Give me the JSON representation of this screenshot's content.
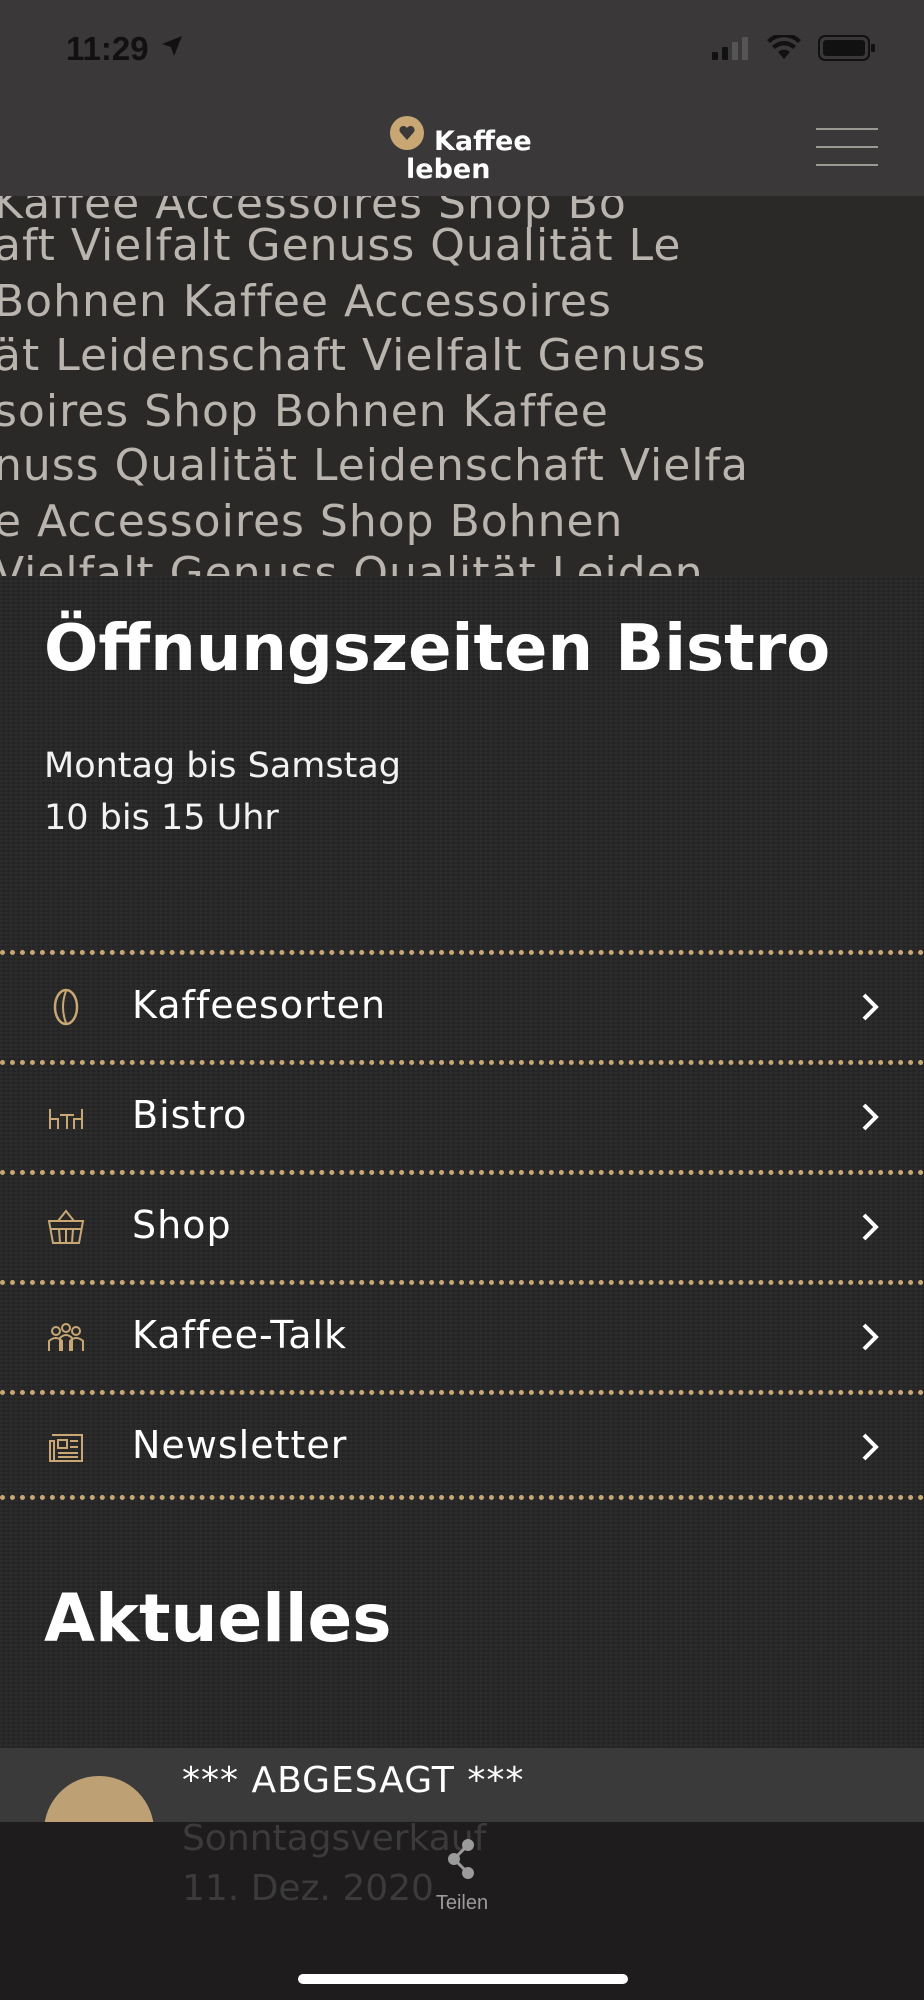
{
  "status_bar": {
    "time": "11:29"
  },
  "header": {
    "logo_line1": "Kaffee",
    "logo_line2": "leben",
    "menu_icon": "hamburger-menu-icon"
  },
  "pattern": {
    "rows": [
      "Kaffee  Accessoires  Shop  Bo",
      "aft  Vielfalt  Genuss  Qualität  Le",
      "  Bohnen  Kaffee  Accessoires",
      "ät  Leidenschaft  Vielfalt  Genuss",
      "soires  Shop  Bohnen  Kaffee",
      "nuss  Qualität  Leidenschaft  Vielfa",
      "e  Accessoires  Shop  Bohnen",
      "Vielfalt  Genuss  Qualität  Leiden"
    ]
  },
  "hours": {
    "title": "Öffnungszeiten Bistro",
    "line1": "Montag bis Samstag",
    "line2": "10 bis 15 Uhr"
  },
  "menu": {
    "items": [
      {
        "label": "Kaffeesorten",
        "icon": "coffee-bean-icon"
      },
      {
        "label": "Bistro",
        "icon": "bistro-table-icon"
      },
      {
        "label": "Shop",
        "icon": "basket-icon"
      },
      {
        "label": "Kaffee-Talk",
        "icon": "people-icon"
      },
      {
        "label": "Newsletter",
        "icon": "newspaper-icon"
      }
    ],
    "accent_color": "#c8a774"
  },
  "news": {
    "title": "Aktuelles",
    "item_title": "*** ABGESAGT ***",
    "item_sub1": "Sonntagsverkauf",
    "item_sub2": "11. Dez. 2020"
  },
  "tabbar": {
    "share_label": "Teilen",
    "share_icon": "share-icon"
  }
}
